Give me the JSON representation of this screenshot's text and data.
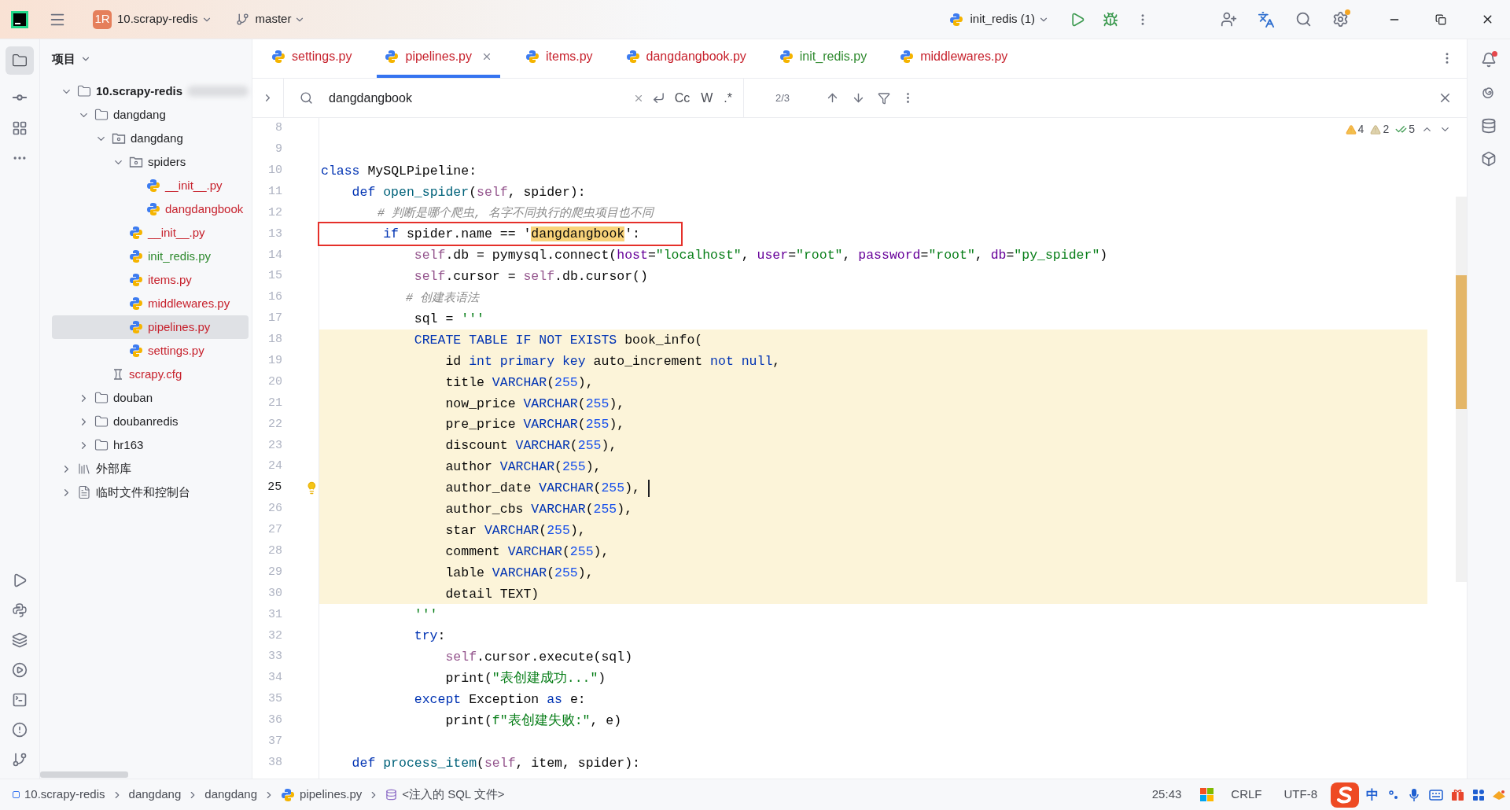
{
  "title_bar": {
    "project_badge": "1R",
    "project": "10.scrapy-redis",
    "branch": "master",
    "run_config": "init_redis (1)"
  },
  "project_panel": {
    "title": "项目",
    "tree": [
      {
        "label": "10.scrapy-redis",
        "kind": "project",
        "color": "#1e1f22",
        "expanded": true,
        "selected": false,
        "children": [
          {
            "label": "dangdang",
            "kind": "folder",
            "color": "#1e1f22",
            "expanded": true,
            "selected": false,
            "children": [
              {
                "label": "dangdang",
                "kind": "package",
                "color": "#1e1f22",
                "expanded": true,
                "selected": false,
                "children": [
                  {
                    "label": "spiders",
                    "kind": "package",
                    "color": "#1e1f22",
                    "expanded": true,
                    "selected": false,
                    "children": [
                      {
                        "label": "__init__.py",
                        "kind": "python",
                        "color": "#c7222d",
                        "expanded": false,
                        "selected": false
                      },
                      {
                        "label": "dangdangbook",
                        "kind": "python",
                        "color": "#c7222d",
                        "expanded": false,
                        "selected": false
                      }
                    ]
                  },
                  {
                    "label": "__init__.py",
                    "kind": "python",
                    "color": "#c7222d",
                    "expanded": false,
                    "selected": false
                  },
                  {
                    "label": "init_redis.py",
                    "kind": "python",
                    "color": "#2f8a2f",
                    "expanded": false,
                    "selected": false
                  },
                  {
                    "label": "items.py",
                    "kind": "python",
                    "color": "#c7222d",
                    "expanded": false,
                    "selected": false
                  },
                  {
                    "label": "middlewares.py",
                    "kind": "python",
                    "color": "#c7222d",
                    "expanded": false,
                    "selected": false
                  },
                  {
                    "label": "pipelines.py",
                    "kind": "python",
                    "color": "#c7222d",
                    "expanded": false,
                    "selected": true
                  },
                  {
                    "label": "settings.py",
                    "kind": "python",
                    "color": "#c7222d",
                    "expanded": false,
                    "selected": false
                  }
                ]
              },
              {
                "label": "scrapy.cfg",
                "kind": "config",
                "color": "#c7222d",
                "expanded": false,
                "selected": false
              }
            ]
          },
          {
            "label": "douban",
            "kind": "folder",
            "color": "#1e1f22",
            "expanded": false,
            "selected": false
          },
          {
            "label": "doubanredis",
            "kind": "folder",
            "color": "#1e1f22",
            "expanded": false,
            "selected": false
          },
          {
            "label": "hr163",
            "kind": "folder",
            "color": "#1e1f22",
            "expanded": false,
            "selected": false
          }
        ]
      },
      {
        "label": "外部库",
        "kind": "library",
        "color": "#1e1f22",
        "expanded": false,
        "selected": false
      },
      {
        "label": "临时文件和控制台",
        "kind": "scratches",
        "color": "#1e1f22",
        "expanded": false,
        "selected": false
      }
    ]
  },
  "tabs": [
    {
      "label": "settings.py",
      "color": "#c7222d",
      "selected": false
    },
    {
      "label": "pipelines.py",
      "color": "#c7222d",
      "selected": true
    },
    {
      "label": "items.py",
      "color": "#c7222d",
      "selected": false
    },
    {
      "label": "dangdangbook.py",
      "color": "#c7222d",
      "selected": false
    },
    {
      "label": "init_redis.py",
      "color": "#2f8a2f",
      "selected": false
    },
    {
      "label": "middlewares.py",
      "color": "#c7222d",
      "selected": false
    }
  ],
  "search": {
    "value": "dangdangbook",
    "options": [
      "Cc",
      "W",
      ".*"
    ],
    "count": "2/3"
  },
  "inspections": {
    "warnings": "4",
    "weak_warnings": "2",
    "ok": "5"
  },
  "code": [
    {
      "number": "8",
      "injected": false,
      "boxed": false,
      "current": false
    },
    {
      "number": "9",
      "injected": false,
      "boxed": false,
      "current": false
    },
    {
      "number": "10",
      "injected": false,
      "boxed": false,
      "current": false,
      "tokens": [
        {
          "kind": "kw",
          "text": "class "
        },
        {
          "kind": "plain",
          "text": "MySQLPipeline:"
        }
      ]
    },
    {
      "number": "11",
      "injected": false,
      "boxed": false,
      "current": false,
      "tokens": [
        {
          "kind": "kw",
          "text": "    def "
        },
        {
          "kind": "fn",
          "text": "open_spider"
        },
        {
          "kind": "plain",
          "text": "("
        },
        {
          "kind": "self",
          "text": "self"
        },
        {
          "kind": "plain",
          "text": ", spider):"
        }
      ]
    },
    {
      "number": "12",
      "injected": false,
      "boxed": false,
      "current": false,
      "tokens": [
        {
          "kind": "comment",
          "text": "        # 判断是哪个爬虫, 名字不同执行的爬虫项目也不同"
        }
      ]
    },
    {
      "number": "13",
      "injected": false,
      "boxed": true,
      "current": false,
      "tokens": [
        {
          "kind": "kw",
          "text": "        if "
        },
        {
          "kind": "plain",
          "text": "spider.name == '"
        },
        {
          "kind": "match",
          "text": "dangdangbook"
        },
        {
          "kind": "plain",
          "text": "':"
        }
      ]
    },
    {
      "number": "14",
      "injected": false,
      "boxed": false,
      "current": false,
      "tokens": [
        {
          "kind": "self",
          "text": "            self"
        },
        {
          "kind": "plain",
          "text": ".db = pymysql.connect("
        },
        {
          "kind": "param",
          "text": "host"
        },
        {
          "kind": "plain",
          "text": "="
        },
        {
          "kind": "str",
          "text": "\"localhost\""
        },
        {
          "kind": "plain",
          "text": ", "
        },
        {
          "kind": "param",
          "text": "user"
        },
        {
          "kind": "plain",
          "text": "="
        },
        {
          "kind": "str",
          "text": "\"root\""
        },
        {
          "kind": "plain",
          "text": ", "
        },
        {
          "kind": "param",
          "text": "password"
        },
        {
          "kind": "plain",
          "text": "="
        },
        {
          "kind": "str",
          "text": "\"root\""
        },
        {
          "kind": "plain",
          "text": ", "
        },
        {
          "kind": "param",
          "text": "db"
        },
        {
          "kind": "plain",
          "text": "="
        },
        {
          "kind": "str",
          "text": "\"py_spider\""
        },
        {
          "kind": "plain",
          "text": ")"
        }
      ]
    },
    {
      "number": "15",
      "injected": false,
      "boxed": false,
      "current": false,
      "tokens": [
        {
          "kind": "self",
          "text": "            self"
        },
        {
          "kind": "plain",
          "text": ".cursor = "
        },
        {
          "kind": "self",
          "text": "self"
        },
        {
          "kind": "plain",
          "text": ".db.cursor()"
        }
      ]
    },
    {
      "number": "16",
      "injected": false,
      "boxed": false,
      "current": false,
      "tokens": [
        {
          "kind": "comment",
          "text": "            # 创建表语法"
        }
      ]
    },
    {
      "number": "17",
      "injected": false,
      "boxed": false,
      "current": false,
      "tokens": [
        {
          "kind": "plain",
          "text": "            sql = "
        },
        {
          "kind": "str",
          "text": "'''"
        }
      ]
    },
    {
      "number": "18",
      "injected": true,
      "boxed": false,
      "current": false,
      "tokens": [
        {
          "kind": "kw",
          "text": "            CREATE TABLE IF NOT EXISTS "
        },
        {
          "kind": "plain",
          "text": "book_info("
        }
      ]
    },
    {
      "number": "19",
      "injected": true,
      "boxed": false,
      "current": false,
      "tokens": [
        {
          "kind": "plain",
          "text": "                id "
        },
        {
          "kind": "kw",
          "text": "int primary key "
        },
        {
          "kind": "plain",
          "text": "auto_increment "
        },
        {
          "kind": "kw",
          "text": "not null"
        },
        {
          "kind": "plain",
          "text": ","
        }
      ]
    },
    {
      "number": "20",
      "injected": true,
      "boxed": false,
      "current": false,
      "tokens": [
        {
          "kind": "plain",
          "text": "                title "
        },
        {
          "kind": "kw",
          "text": "VARCHAR"
        },
        {
          "kind": "plain",
          "text": "("
        },
        {
          "kind": "num",
          "text": "255"
        },
        {
          "kind": "plain",
          "text": "),"
        }
      ]
    },
    {
      "number": "21",
      "injected": true,
      "boxed": false,
      "current": false,
      "tokens": [
        {
          "kind": "plain",
          "text": "                now_price "
        },
        {
          "kind": "kw",
          "text": "VARCHAR"
        },
        {
          "kind": "plain",
          "text": "("
        },
        {
          "kind": "num",
          "text": "255"
        },
        {
          "kind": "plain",
          "text": "),"
        }
      ]
    },
    {
      "number": "22",
      "injected": true,
      "boxed": false,
      "current": false,
      "tokens": [
        {
          "kind": "plain",
          "text": "                pre_price "
        },
        {
          "kind": "kw",
          "text": "VARCHAR"
        },
        {
          "kind": "plain",
          "text": "("
        },
        {
          "kind": "num",
          "text": "255"
        },
        {
          "kind": "plain",
          "text": "),"
        }
      ]
    },
    {
      "number": "23",
      "injected": true,
      "boxed": false,
      "current": false,
      "tokens": [
        {
          "kind": "plain",
          "text": "                discount "
        },
        {
          "kind": "kw",
          "text": "VARCHAR"
        },
        {
          "kind": "plain",
          "text": "("
        },
        {
          "kind": "num",
          "text": "255"
        },
        {
          "kind": "plain",
          "text": "),"
        }
      ]
    },
    {
      "number": "24",
      "injected": true,
      "boxed": false,
      "current": false,
      "tokens": [
        {
          "kind": "plain",
          "text": "                author "
        },
        {
          "kind": "kw",
          "text": "VARCHAR"
        },
        {
          "kind": "plain",
          "text": "("
        },
        {
          "kind": "num",
          "text": "255"
        },
        {
          "kind": "plain",
          "text": "),"
        }
      ]
    },
    {
      "number": "25",
      "injected": true,
      "boxed": false,
      "current": true,
      "tokens": [
        {
          "kind": "plain",
          "text": "                author_date "
        },
        {
          "kind": "kw",
          "text": "VARCHAR"
        },
        {
          "kind": "plain",
          "text": "("
        },
        {
          "kind": "num",
          "text": "255"
        },
        {
          "kind": "plain",
          "text": "),"
        }
      ]
    },
    {
      "number": "26",
      "injected": true,
      "boxed": false,
      "current": false,
      "tokens": [
        {
          "kind": "plain",
          "text": "                author_cbs "
        },
        {
          "kind": "kw",
          "text": "VARCHAR"
        },
        {
          "kind": "plain",
          "text": "("
        },
        {
          "kind": "num",
          "text": "255"
        },
        {
          "kind": "plain",
          "text": "),"
        }
      ]
    },
    {
      "number": "27",
      "injected": true,
      "boxed": false,
      "current": false,
      "tokens": [
        {
          "kind": "plain",
          "text": "                star "
        },
        {
          "kind": "kw",
          "text": "VARCHAR"
        },
        {
          "kind": "plain",
          "text": "("
        },
        {
          "kind": "num",
          "text": "255"
        },
        {
          "kind": "plain",
          "text": "),"
        }
      ]
    },
    {
      "number": "28",
      "injected": true,
      "boxed": false,
      "current": false,
      "tokens": [
        {
          "kind": "plain",
          "text": "                comment "
        },
        {
          "kind": "kw",
          "text": "VARCHAR"
        },
        {
          "kind": "plain",
          "text": "("
        },
        {
          "kind": "num",
          "text": "255"
        },
        {
          "kind": "plain",
          "text": "),"
        }
      ]
    },
    {
      "number": "29",
      "injected": true,
      "boxed": false,
      "current": false,
      "tokens": [
        {
          "kind": "plain",
          "text": "                lable "
        },
        {
          "kind": "kw",
          "text": "VARCHAR"
        },
        {
          "kind": "plain",
          "text": "("
        },
        {
          "kind": "num",
          "text": "255"
        },
        {
          "kind": "plain",
          "text": "),"
        }
      ]
    },
    {
      "number": "30",
      "injected": true,
      "boxed": false,
      "current": false,
      "tokens": [
        {
          "kind": "plain",
          "text": "                detail TEXT)"
        }
      ]
    },
    {
      "number": "31",
      "injected": false,
      "boxed": false,
      "current": false,
      "tokens": [
        {
          "kind": "str",
          "text": "            '''"
        }
      ]
    },
    {
      "number": "32",
      "injected": false,
      "boxed": false,
      "current": false,
      "tokens": [
        {
          "kind": "kw",
          "text": "            try"
        },
        {
          "kind": "plain",
          "text": ":"
        }
      ]
    },
    {
      "number": "33",
      "injected": false,
      "boxed": false,
      "current": false,
      "tokens": [
        {
          "kind": "self",
          "text": "                self"
        },
        {
          "kind": "plain",
          "text": ".cursor.execute(sql)"
        }
      ]
    },
    {
      "number": "34",
      "injected": false,
      "boxed": false,
      "current": false,
      "tokens": [
        {
          "kind": "plain",
          "text": "                print("
        },
        {
          "kind": "str",
          "text": "\"表创建成功...\""
        },
        {
          "kind": "plain",
          "text": ")"
        }
      ]
    },
    {
      "number": "35",
      "injected": false,
      "boxed": false,
      "current": false,
      "tokens": [
        {
          "kind": "kw",
          "text": "            except "
        },
        {
          "kind": "plain",
          "text": "Exception "
        },
        {
          "kind": "kw",
          "text": "as "
        },
        {
          "kind": "plain",
          "text": "e:"
        }
      ]
    },
    {
      "number": "36",
      "injected": false,
      "boxed": false,
      "current": false,
      "tokens": [
        {
          "kind": "plain",
          "text": "                print("
        },
        {
          "kind": "str",
          "text": "f\"表创建失败:\""
        },
        {
          "kind": "plain",
          "text": ", e)"
        }
      ]
    },
    {
      "number": "37",
      "injected": false,
      "boxed": false,
      "current": false
    },
    {
      "number": "38",
      "injected": false,
      "boxed": false,
      "current": false,
      "tokens": [
        {
          "kind": "kw",
          "text": "    def "
        },
        {
          "kind": "fn",
          "text": "process_item"
        },
        {
          "kind": "plain",
          "text": "("
        },
        {
          "kind": "self",
          "text": "self"
        },
        {
          "kind": "plain",
          "text": ", item, spider):"
        }
      ]
    }
  ],
  "breadcrumbs": [
    {
      "label": "10.scrapy-redis",
      "kind": "module"
    },
    {
      "label": "dangdang",
      "kind": "plain"
    },
    {
      "label": "dangdang",
      "kind": "plain"
    },
    {
      "label": "pipelines.py",
      "kind": "python"
    },
    {
      "label": "<注入的 SQL 文件>",
      "kind": "sql"
    }
  ],
  "status": {
    "position": "25:43",
    "line_separator": "CRLF",
    "encoding": "UTF-8",
    "ime": "中"
  }
}
